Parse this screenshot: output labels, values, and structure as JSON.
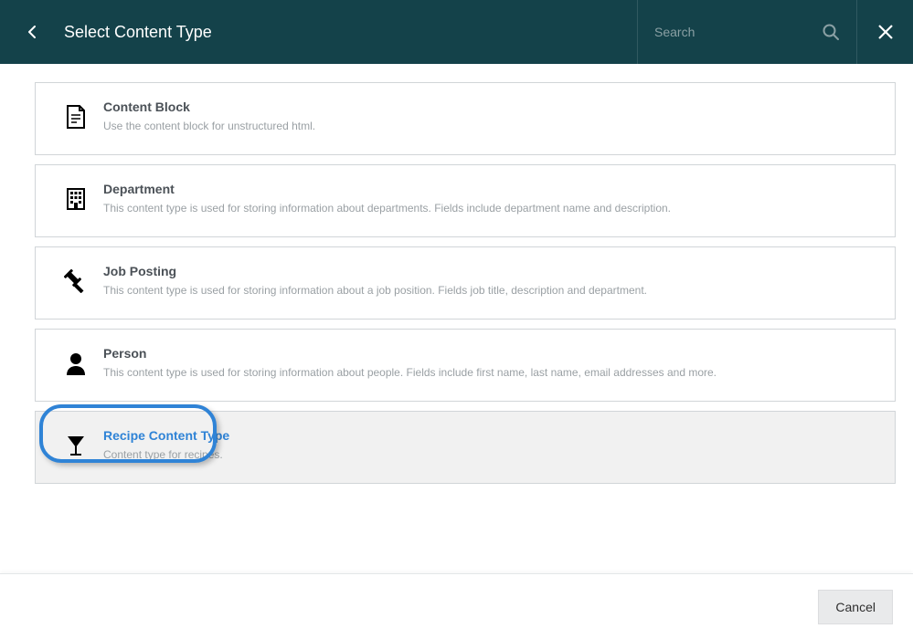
{
  "header": {
    "title": "Select Content Type",
    "search_placeholder": "Search"
  },
  "content_types": [
    {
      "icon": "document",
      "title": "Content Block",
      "description": "Use the content block for unstructured html.",
      "selected": false
    },
    {
      "icon": "building",
      "title": "Department",
      "description": "This content type is used for storing information about departments. Fields include department name and description.",
      "selected": false
    },
    {
      "icon": "gavel",
      "title": "Job Posting",
      "description": "This content type is used for storing information about a job position. Fields job title, description and department.",
      "selected": false
    },
    {
      "icon": "person",
      "title": "Person",
      "description": "This content type is used for storing information about people. Fields include first name, last name, email addresses and more.",
      "selected": false
    },
    {
      "icon": "cocktail",
      "title": "Recipe Content Type",
      "description": "Content type for recipes.",
      "selected": true
    }
  ],
  "footer": {
    "cancel_label": "Cancel"
  }
}
